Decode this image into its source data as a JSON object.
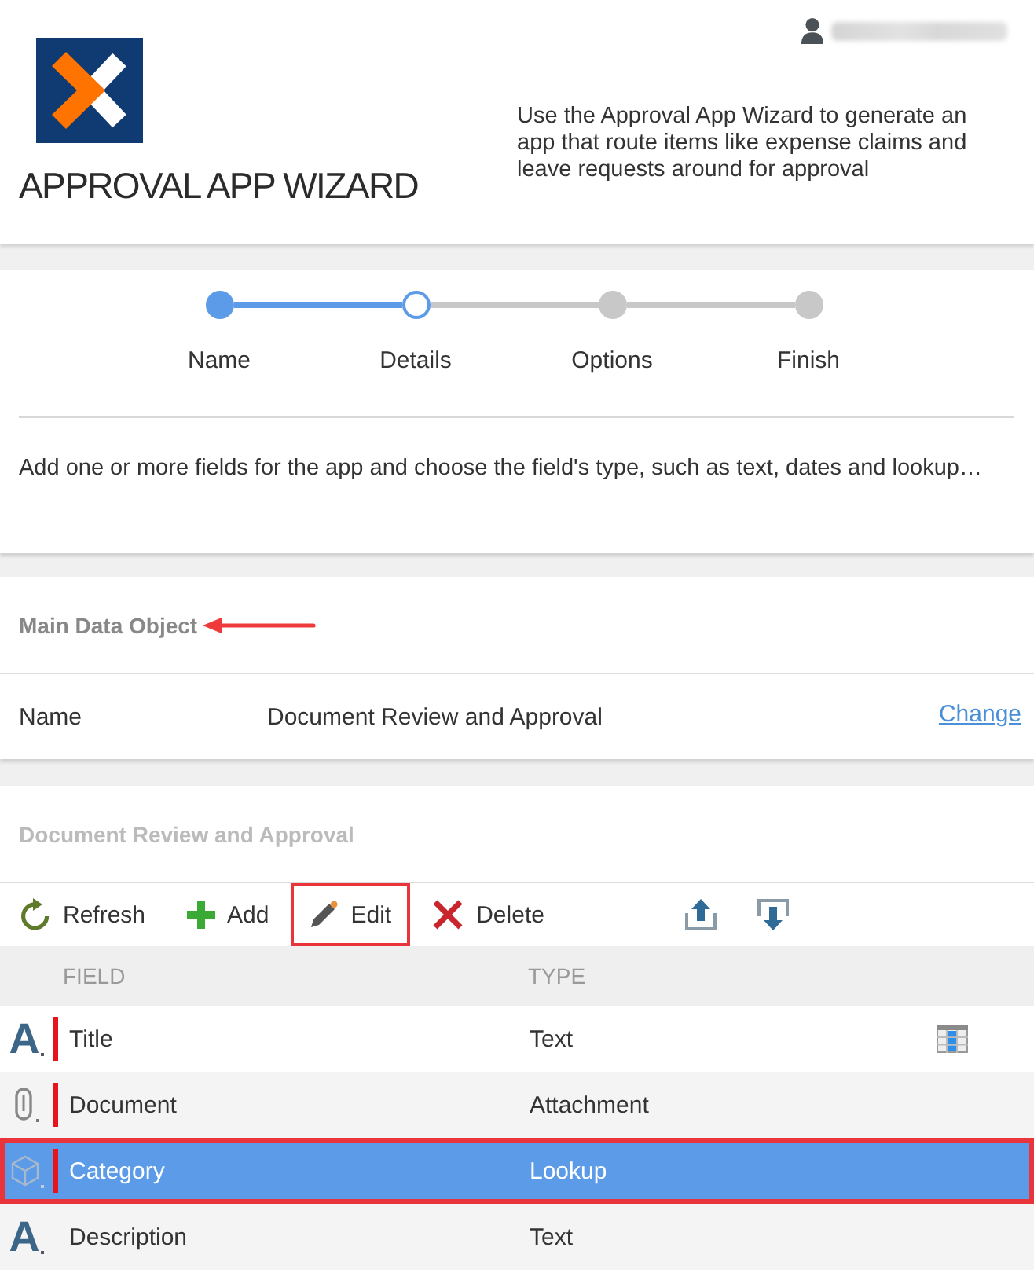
{
  "header": {
    "title": "APPROVAL APP WIZARD",
    "description": "Use the Approval App Wizard to generate an app that route items like expense claims and leave requests around for approval"
  },
  "stepper": {
    "steps": [
      {
        "label": "Name",
        "completed": true,
        "current": false
      },
      {
        "label": "Details",
        "completed": false,
        "current": true
      },
      {
        "label": "Options",
        "completed": false,
        "current": false
      },
      {
        "label": "Finish",
        "completed": false,
        "current": false
      }
    ],
    "instructions": "Add one or more fields for the app and choose the field's type, such as text, dates and lookup…"
  },
  "main_data_object": {
    "heading": "Main Data Object",
    "arrow": true,
    "name_label": "Name",
    "name_value": "Document Review and Approval",
    "link": "Change"
  },
  "fields_panel": {
    "heading": "Document Review and Approval",
    "toolbar": [
      {
        "kind": "refresh",
        "label": "Refresh",
        "highlighted": false
      },
      {
        "kind": "add",
        "label": "Add",
        "highlighted": false
      },
      {
        "kind": "edit",
        "label": "Edit",
        "highlighted": true
      },
      {
        "kind": "delete",
        "label": "Delete",
        "highlighted": false
      },
      {
        "kind": "upload",
        "highlighted": false
      },
      {
        "kind": "download",
        "highlighted": false
      }
    ],
    "table": {
      "columns": [
        "FIELD",
        "TYPE"
      ],
      "rows": [
        {
          "kind": "text",
          "icon": "A",
          "field": "Title",
          "type": "Text",
          "required": true,
          "grid_icon": true,
          "selected": false,
          "highlighted": false
        },
        {
          "kind": "attachment",
          "field": "Document",
          "type": "Attachment",
          "required": true,
          "grid_icon": false,
          "selected": false,
          "highlighted": false
        },
        {
          "kind": "lookup",
          "field": "Category",
          "type": "Lookup",
          "required": true,
          "grid_icon": false,
          "selected": true,
          "highlighted": true
        },
        {
          "kind": "text",
          "icon": "A",
          "field": "Description",
          "type": "Text",
          "required": false,
          "grid_icon": false,
          "selected": false,
          "highlighted": false
        }
      ]
    }
  }
}
